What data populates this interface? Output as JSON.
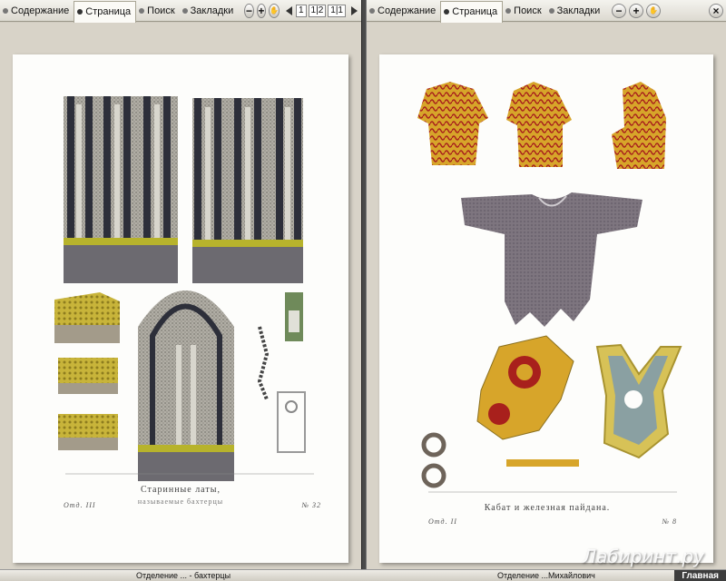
{
  "left_toolbar": {
    "tabs": [
      "Содержание",
      "Страница",
      "Поиск",
      "Закладки"
    ],
    "zoom_out": "−",
    "zoom_in": "+",
    "pages": [
      "1",
      "1|2",
      "1|1"
    ]
  },
  "right_toolbar": {
    "tabs": [
      "Содержание",
      "Страница",
      "Поиск",
      "Закладки"
    ],
    "zoom_out": "−",
    "zoom_in": "+",
    "close": "×"
  },
  "left_page": {
    "title": "Старинные латы,",
    "subtitle": "называемые бахтерцы",
    "dept": "Отд. III",
    "number": "№ 32"
  },
  "right_page": {
    "title": "Кабат и железная пайдана.",
    "dept": "Отд. II",
    "number": "№ 8"
  },
  "statusbar": {
    "left_text": "Отделение ... - бахтерцы",
    "right_text": "Отделение ...Михайлович",
    "home": "Главная"
  },
  "watermark": "Лабиринт.ру",
  "colors": {
    "toolbar": "#e6e3db",
    "divider": "#4a4a4a",
    "background": "#d8d3c8",
    "sheet": "#fdfdfb"
  }
}
